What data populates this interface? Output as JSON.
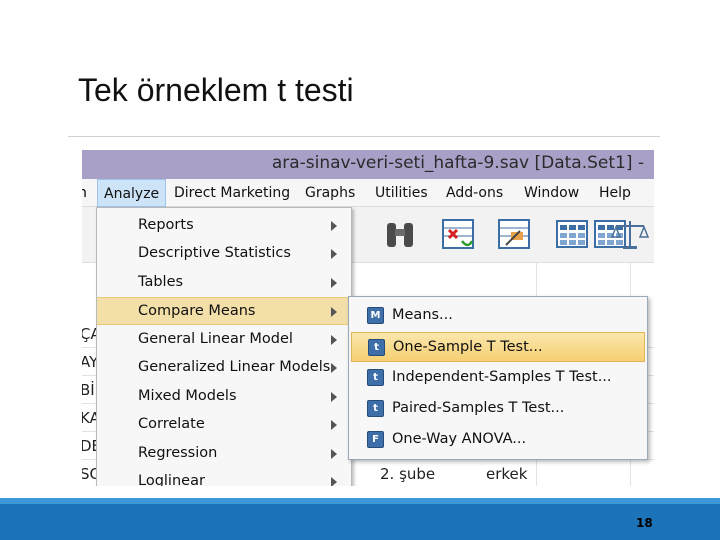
{
  "slide": {
    "title": "Tek örneklem t testi",
    "page_number": "18"
  },
  "window": {
    "title": "ara-sinav-veri-seti_hafta-9.sav [Data.Set1] -"
  },
  "menubar": {
    "left_edge": "n",
    "items": [
      "Analyze",
      "Direct Marketing",
      "Graphs",
      "Utilities",
      "Add-ons",
      "Window",
      "Help"
    ]
  },
  "toolbar": {
    "icons": [
      "binoculars-icon",
      "select-cases-icon",
      "chart-builder-icon",
      "value-labels-icon",
      "use-sets-icon",
      "balance-scale-icon"
    ]
  },
  "grid": {
    "row_stubs": [
      "ÇA",
      "AY",
      "Bİ",
      "KA",
      "DE",
      "SO"
    ],
    "last_row": {
      "group": "2. şube",
      "gender": "erkek"
    }
  },
  "analyze_menu": {
    "items": [
      "Reports",
      "Descriptive Statistics",
      "Tables",
      "Compare Means",
      "General Linear Model",
      "Generalized Linear Models",
      "Mixed Models",
      "Correlate",
      "Regression",
      "Loglinear"
    ],
    "highlighted": "Compare Means"
  },
  "compare_means_menu": {
    "items": [
      {
        "label": "Means...",
        "icon": "M"
      },
      {
        "label": "One-Sample T Test...",
        "icon": "t"
      },
      {
        "label": "Independent-Samples T Test...",
        "icon": "t"
      },
      {
        "label": "Paired-Samples T Test...",
        "icon": "t"
      },
      {
        "label": "One-Way ANOVA...",
        "icon": "F"
      }
    ],
    "highlighted": "One-Sample T Test..."
  },
  "colors": {
    "titlebar": "#a9a0c8",
    "menu_highlight": "#f3dfa8",
    "submenu_highlight": "#f5cf72",
    "footer": "#1d73b8",
    "icon_blue": "#3f6fa8"
  }
}
